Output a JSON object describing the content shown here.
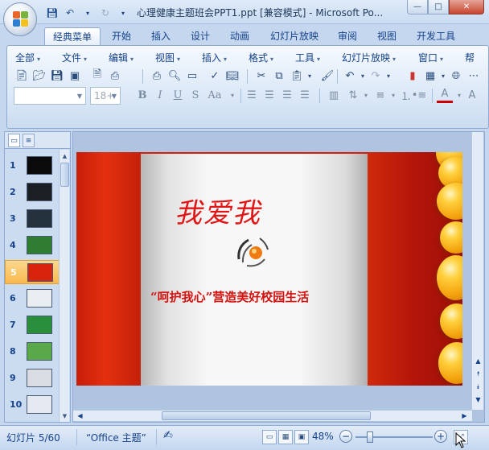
{
  "window": {
    "title": "心理健康主题班会PPT1.ppt [兼容模式] - Microsoft Po...",
    "min_glyph": "—",
    "max_glyph": "□",
    "close_glyph": "✕"
  },
  "ribbon_tabs": [
    "经典菜单",
    "开始",
    "插入",
    "设计",
    "动画",
    "幻灯片放映",
    "审阅",
    "视图",
    "开发工具"
  ],
  "classic_menus": [
    "全部",
    "文件",
    "编辑",
    "视图",
    "插入",
    "格式",
    "工具",
    "幻灯片放映",
    "窗口",
    "帮"
  ],
  "toolbar": {
    "font_name": "",
    "font_size": "18+",
    "bold": "B",
    "italic": "I",
    "underline": "U",
    "shadow": "S",
    "change_case": "Aa"
  },
  "slides": [
    {
      "num": "1",
      "color": "#0a0a0a"
    },
    {
      "num": "2",
      "color": "#1a1f24"
    },
    {
      "num": "3",
      "color": "#25323e"
    },
    {
      "num": "4",
      "color": "#2e7d33"
    },
    {
      "num": "5",
      "color": "#d8240a"
    },
    {
      "num": "6",
      "color": "#e9eef0"
    },
    {
      "num": "7",
      "color": "#2a8f3c"
    },
    {
      "num": "8",
      "color": "#5aa84a"
    },
    {
      "num": "9",
      "color": "#d9dce2"
    },
    {
      "num": "10",
      "color": "#e4e9f2"
    }
  ],
  "selected_slide": "5",
  "slide": {
    "title": "我爱我",
    "subtitle": "“呵护我心”营造美好校园生活"
  },
  "status": {
    "slide_info": "幻灯片 5/60",
    "theme": "“Office 主题”",
    "zoom": "48%",
    "zoom_minus": "−",
    "zoom_plus": "+"
  },
  "colors": {
    "accent": "#15428b",
    "slide_red": "#d81e05",
    "title_red": "#e11416",
    "selection": "#f9b94e"
  }
}
